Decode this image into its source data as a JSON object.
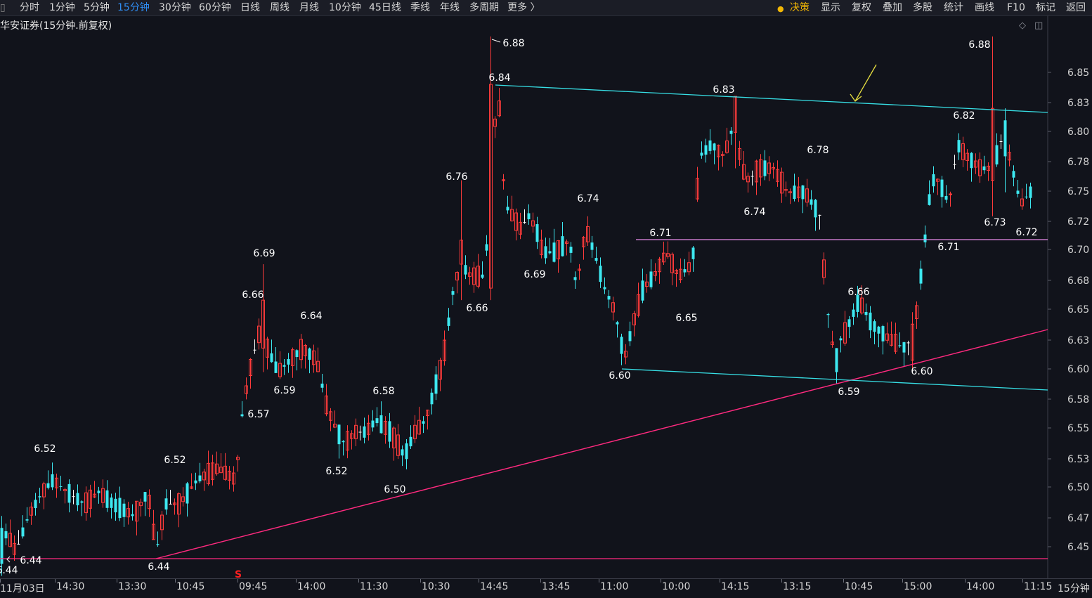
{
  "toolbar": {
    "left_items": [
      "分时",
      "1分钟",
      "5分钟",
      "15分钟",
      "30分钟",
      "60分钟",
      "日线",
      "周线",
      "月线",
      "10分钟",
      "45日线",
      "季线",
      "年线",
      "多周期",
      "更多 〉"
    ],
    "active": "15分钟",
    "right_items": [
      "决策",
      "显示",
      "复权",
      "叠加",
      "多股",
      "统计",
      "画线",
      "F10",
      "标记",
      "返回"
    ]
  },
  "stock_title": "华安证券(15分钟.前复权)",
  "y_axis": {
    "ticks": [
      "6.85",
      "6.83",
      "6.80",
      "6.78",
      "6.75",
      "6.72",
      "6.70",
      "6.68",
      "6.65",
      "6.63",
      "6.60",
      "6.58",
      "6.55",
      "6.53",
      "6.50",
      "6.47",
      "6.45"
    ],
    "period_label": "15分钟"
  },
  "x_axis": {
    "labels": [
      "11月03日",
      "14:30",
      "13:30",
      "10:45",
      "09:45",
      "14:00",
      "11:30",
      "10:30",
      "14:45",
      "13:45",
      "11:00",
      "10:00",
      "14:15",
      "13:15",
      "10:45",
      "15:00",
      "14:00",
      "11:15"
    ]
  },
  "annotations": [
    "6.44",
    "6.44",
    "6.52",
    "6.52",
    "6.44",
    "6.69",
    "6.66",
    "6.57",
    "6.59",
    "6.64",
    "6.52",
    "6.58",
    "6.50",
    "6.76",
    "6.66",
    "6.88",
    "6.84",
    "6.69",
    "6.74",
    "6.60",
    "6.71",
    "6.65",
    "6.83",
    "6.74",
    "6.78",
    "6.66",
    "6.59",
    "6.60",
    "6.71",
    "6.82",
    "6.88",
    "6.73",
    "6.72"
  ],
  "signal_marker": "S",
  "colors": {
    "up": "#ff3b3b",
    "down": "#3de8f0",
    "neutral": "#ffffff",
    "trend_magenta": "#ff2a7f",
    "channel_cyan": "#37e0e6",
    "support_violet": "#e58be8",
    "arrow_yellow": "#e8e040",
    "toolbar_active": "#2f8cf0"
  },
  "chart_data": {
    "type": "candlestick",
    "title": "华安证券(15分钟.前复权)",
    "ylim": [
      6.42,
      6.9
    ],
    "highlighted_prices": {
      "high": 6.88,
      "low": 6.44,
      "labels": [
        6.44,
        6.52,
        6.52,
        6.69,
        6.66,
        6.57,
        6.59,
        6.64,
        6.52,
        6.58,
        6.5,
        6.76,
        6.66,
        6.84,
        6.69,
        6.74,
        6.6,
        6.71,
        6.65,
        6.83,
        6.74,
        6.78,
        6.66,
        6.59,
        6.6,
        6.71,
        6.82,
        6.88,
        6.73,
        6.72
      ]
    }
  }
}
